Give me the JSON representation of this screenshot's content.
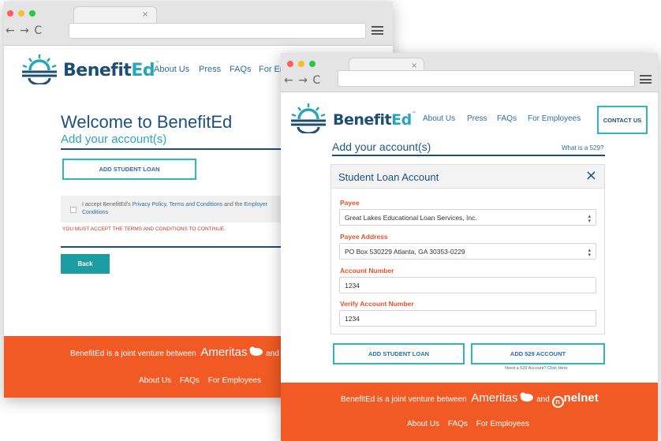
{
  "brand": {
    "name_main": "Benefit",
    "name_accent": "Ed",
    "trademark": "™"
  },
  "colors": {
    "navy": "#1e4e72",
    "teal": "#27a7b8",
    "orange": "#f15a24",
    "link": "#2c6ea8",
    "error": "#c0392b"
  },
  "back_window": {
    "nav": [
      "About Us",
      "Press",
      "FAQs",
      "For Em"
    ],
    "title": "Welcome to BenefitEd",
    "subtitle": "Add your account(s)",
    "add_student_loan": "ADD STUDENT LOAN",
    "terms": {
      "prefix": "I accept BenefitEd's ",
      "privacy": "Privacy Policy",
      "sep": ", ",
      "terms_link": "Terms and Conditions",
      "and": " and the ",
      "employer": "Employer",
      "conditions": "Conditions"
    },
    "error": "YOU MUST ACCEPT THE TERMS AND CONDITIONS TO CONTINUE.",
    "back_button": "Back",
    "footer": {
      "joint": "BenefitEd is a joint venture between",
      "ameritas": "Ameritas",
      "and": "and",
      "links": [
        "About Us",
        "FAQs",
        "For Employees"
      ]
    }
  },
  "front_window": {
    "nav": [
      "About Us",
      "Press",
      "FAQs",
      "For Employees"
    ],
    "contact": "CONTACT US",
    "subtitle": "Add your account(s)",
    "what_is": "What is a 529?",
    "modal": {
      "title": "Student Loan Account",
      "close": "×",
      "payee_label": "Payee",
      "payee_value": "Great Lakes Educational Loan Services, Inc.",
      "address_label": "Payee Address",
      "address_value": "PO Box 530229 Atlanta, GA 30353-0229",
      "account_label": "Account Number",
      "account_value": "1234",
      "verify_label": "Verify Account Number",
      "verify_value": "1234"
    },
    "add_student_loan": "ADD STUDENT LOAN",
    "add_529": "ADD 529 ACCOUNT",
    "need_529": "Need a 529 Account?",
    "click_here": "Click Here",
    "footer": {
      "joint": "BenefitEd is a joint venture between",
      "ameritas": "Ameritas",
      "and": "and",
      "nelnet": "nelnet",
      "links": [
        "About Us",
        "FAQs",
        "For Employees"
      ]
    }
  }
}
